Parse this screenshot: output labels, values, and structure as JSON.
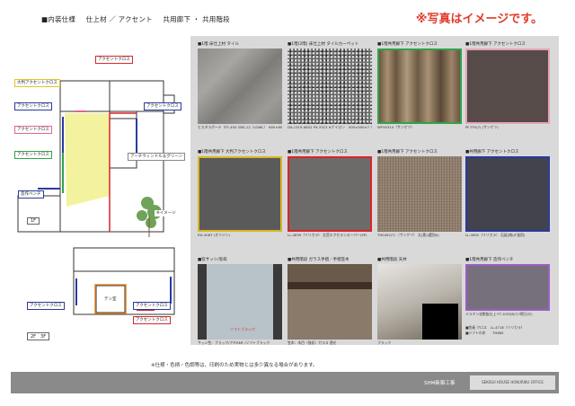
{
  "header": {
    "section": "■内装仕様",
    "category": "仕上材 ／ アクセント",
    "area": "共用廊下 ・ 共用階段"
  },
  "disclaimer": "※写真はイメージです。",
  "plan": {
    "labels": [
      {
        "text": "アクセントクロス",
        "color": "red"
      },
      {
        "text": "大判アクセントクロス",
        "color": "yellow"
      },
      {
        "text": "アクセントクロス",
        "color": "blue"
      },
      {
        "text": "アクセントクロス",
        "color": "blue"
      },
      {
        "text": "アクセントクロス",
        "color": "pink"
      },
      {
        "text": "アクセントクロス",
        "color": "green"
      },
      {
        "text": "アーチウィンドル＆グリーン",
        "color": "plain"
      },
      {
        "text": "造作ベンチ",
        "color": "blue"
      },
      {
        "text": "※イメージ",
        "color": "plain"
      },
      {
        "text": "アクセントクロス",
        "color": "blue"
      },
      {
        "text": "アクセントクロス",
        "color": "blue"
      },
      {
        "text": "アクセントクロス",
        "color": "red"
      }
    ],
    "floor_1": "1F",
    "floor_2": "2F　3F",
    "room_label": "テン室"
  },
  "cells": [
    {
      "title": "■1階 床仕上材 タイル",
      "cap": "ヒスタラボーテ（FF-450 GRS-12（LOWL）　600×600×8.7 イギリス(54)",
      "tex": "tex-stone",
      "border": ""
    },
    {
      "title": "■1階(2階) 床仕上材 タイルカーペット",
      "cap": "DX-1319 AK02 PX-3313 ※ナイロン　500×500×7 ジャブ(ハード) ※北海(リバ)",
      "tex": "tex-carpet",
      "border": ""
    },
    {
      "title": "■1階共用廊下 アクセントクロス",
      "cap": "WFV0314（サンゲツ）",
      "tex": "tex-wood",
      "border": "b-green"
    },
    {
      "title": "■1階共用廊下 アクセントクロス",
      "cap": "PF-TF5(?) (サンゲツ)",
      "tex": "tex-brownish",
      "border": "b-pink"
    },
    {
      "title": "■1階共用廊下 大判アクセントクロス",
      "cap": "RH-4087 (オリジン)",
      "tex": "tex-gray-dark",
      "border": "b-yellow"
    },
    {
      "title": "■1階共用廊下 アクセントクロス",
      "cap": "LL-4839（リリカラ） 左官エクセランスーパー(SP)",
      "tex": "tex-cement",
      "border": "b-red"
    },
    {
      "title": "■1階共用廊下 アクセントクロス",
      "cap": "TH0402(?) （サンゲツ） 太(奥)(選別A)",
      "tex": "tex-pebble",
      "border": ""
    },
    {
      "title": "■共用廊下 アクセントクロス",
      "cap": "LL-4692（リリカラ） 石延(南)(F塗用)",
      "tex": "tex-navy",
      "border": "b-blue"
    },
    {
      "title": "■窓サッシ/窓枠",
      "cap": "サッシ色：ブラック/アミRMF /ソフトブラック",
      "tex": "tex-window",
      "border": ""
    },
    {
      "title": "■共用階段 ガラス手摺／手摺笠木",
      "cap": "笠木：木目（強化）ガラス 透光",
      "tex": "tex-rail",
      "border": ""
    },
    {
      "title": "■共用階段 天井",
      "cap": "ブラック",
      "tex": "tex-stair",
      "border": ""
    },
    {
      "title": "■1階共用廊下 造作ベンチ",
      "cap": "メラミン化粧板仕上 FT-1053JS(?) 明日(沙)",
      "tex": "tex-purple",
      "border": "b-purple"
    }
  ],
  "extra": {
    "sub_title": "■笠板 クロス　LL-4718（リリカラ）",
    "sub_cap": "■ソフト巾木　　TH885",
    "photo_label": "ソフトブラック"
  },
  "note": "※仕様・色柄・色調等は、印刷のため実物とは多少異なる場合があります。",
  "footer": {
    "company": "SHM新築工事",
    "office": "SEKISUI HOUSE  HOKURIKU OFFICE"
  }
}
